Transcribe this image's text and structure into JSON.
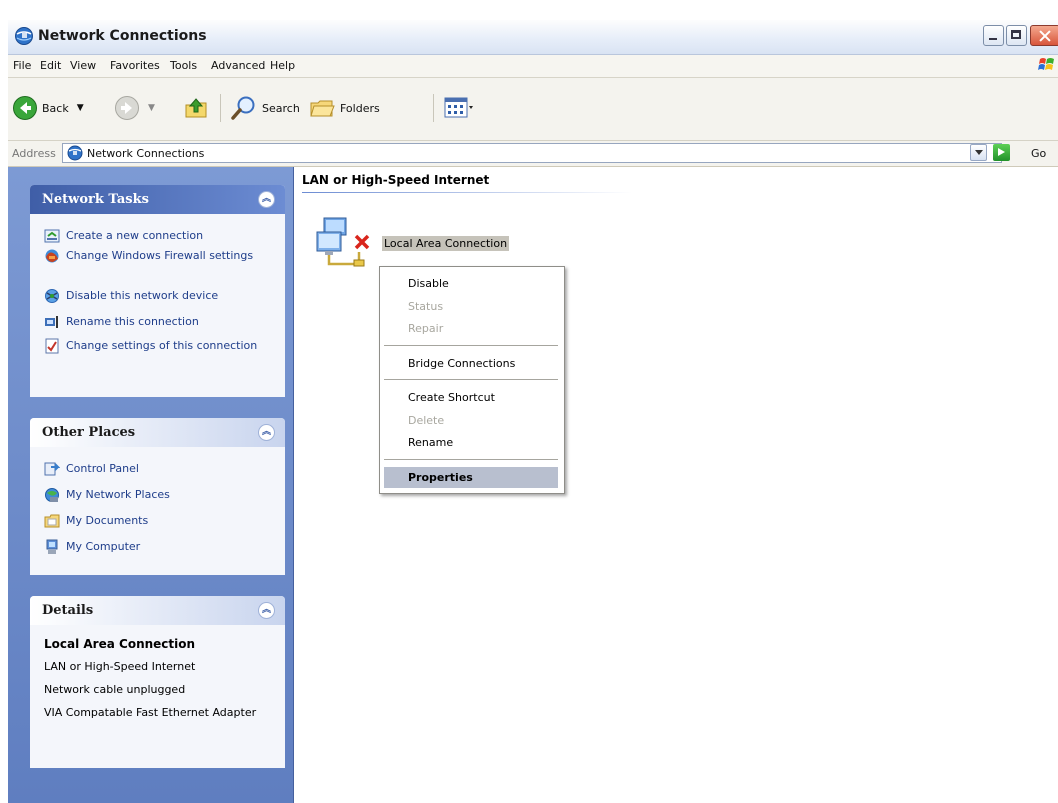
{
  "window": {
    "title": "Network Connections",
    "icon": "network-connections-icon"
  },
  "menu": [
    "File",
    "Edit",
    "View",
    "Favorites",
    "Tools",
    "Advanced",
    "Help"
  ],
  "toolbar": {
    "back": "Back",
    "search": "Search",
    "folders": "Folders"
  },
  "address": {
    "label": "Address",
    "value": "Network Connections",
    "go": "Go"
  },
  "sidebar": {
    "network_tasks": {
      "title": "Network Tasks",
      "items": [
        {
          "label": "Create a new connection",
          "icon": "new-connection-icon"
        },
        {
          "label": "Change Windows Firewall settings",
          "icon": "firewall-icon"
        },
        {
          "label": "Disable this network device",
          "icon": "disable-device-icon"
        },
        {
          "label": "Rename this connection",
          "icon": "rename-icon"
        },
        {
          "label": "Change settings of this connection",
          "icon": "settings-icon"
        }
      ]
    },
    "other_places": {
      "title": "Other Places",
      "items": [
        {
          "label": "Control Panel",
          "icon": "control-panel-icon"
        },
        {
          "label": "My Network Places",
          "icon": "network-places-icon"
        },
        {
          "label": "My Documents",
          "icon": "documents-icon"
        },
        {
          "label": "My Computer",
          "icon": "computer-icon"
        }
      ]
    },
    "details": {
      "title": "Details",
      "name": "Local Area Connection",
      "lines": [
        "LAN or High-Speed Internet",
        "Network cable unplugged",
        "VIA Compatable Fast Ethernet Adapter"
      ]
    }
  },
  "main": {
    "section_title": "LAN or High-Speed Internet",
    "connection_label": "Local Area Connection"
  },
  "context_menu": {
    "items": [
      {
        "label": "Disable",
        "enabled": true
      },
      {
        "label": "Status",
        "enabled": false
      },
      {
        "label": "Repair",
        "enabled": false
      },
      {
        "label": "Bridge Connections",
        "enabled": true
      },
      {
        "label": "Create Shortcut",
        "enabled": true
      },
      {
        "label": "Delete",
        "enabled": false
      },
      {
        "label": "Rename",
        "enabled": true
      },
      {
        "label": "Properties",
        "enabled": true,
        "selected": true
      }
    ]
  }
}
